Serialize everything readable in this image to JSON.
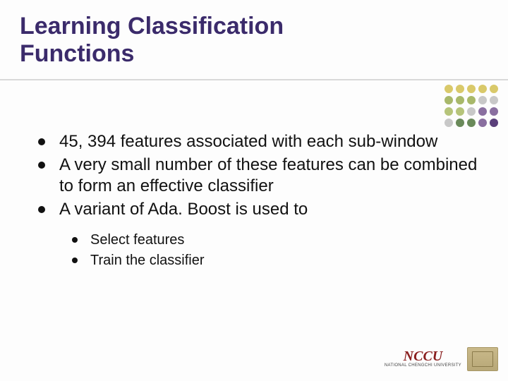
{
  "title_line1": "Learning Classification",
  "title_line2": "Functions",
  "bullets": [
    "45, 394 features associated with each sub-window",
    "A very small number of these features can be combined to form an effective classifier",
    "A variant of Ada. Boost is used to"
  ],
  "sub_bullets": [
    "Select features",
    "Train the classifier"
  ],
  "logo": {
    "main": "NCCU",
    "sub": "NATIONAL CHENGCHI UNIVERSITY"
  },
  "dot_colors": [
    "#d9c96a",
    "#d9c96a",
    "#d9c96a",
    "#d9c96a",
    "#d9c96a",
    "#a8b86a",
    "#a8b86a",
    "#a8b86a",
    "#c8c8c8",
    "#c8c8c8",
    "#b6c47a",
    "#b6c47a",
    "#c8c8c8",
    "#8a6fa0",
    "#8a6fa0",
    "#c8c8c8",
    "#6a8a5a",
    "#6a8a5a",
    "#8a6fa0",
    "#5a3f7a"
  ]
}
